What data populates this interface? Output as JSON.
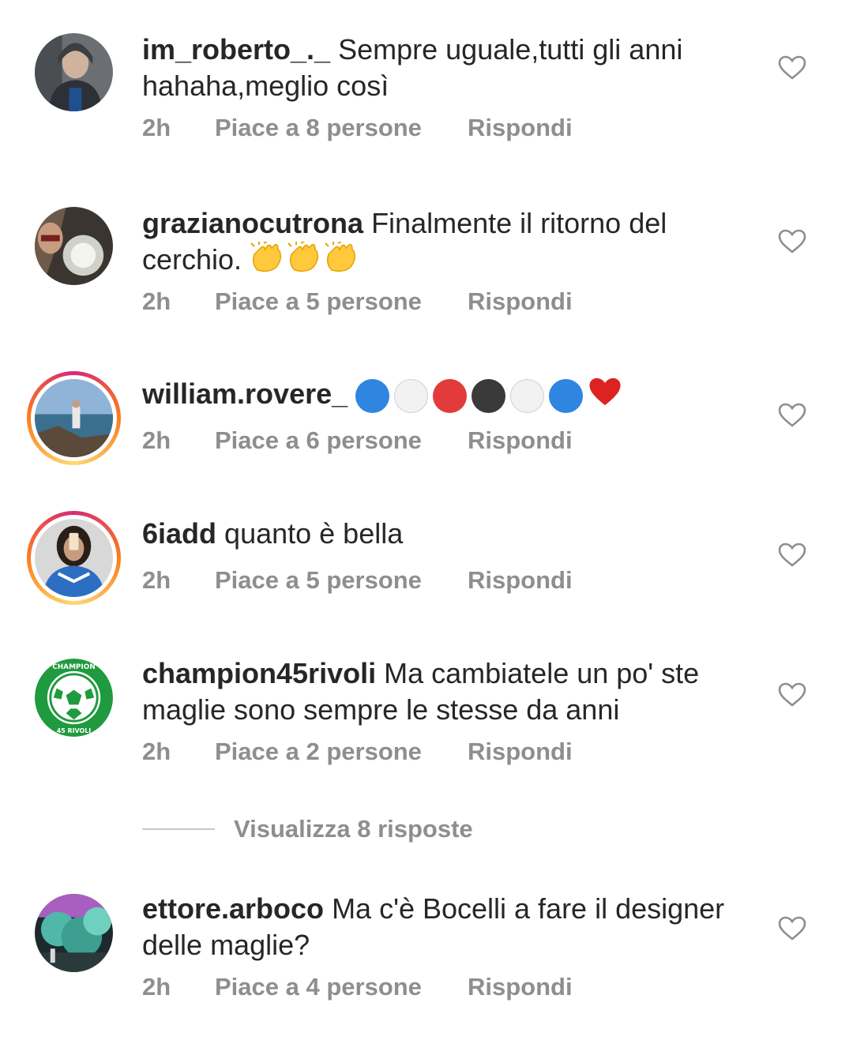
{
  "comments": [
    {
      "username": "im_roberto_._",
      "text": "Sempre uguale,tutti gli anni hahaha,meglio così",
      "time": "2h",
      "likes": "Piace a 8 persone",
      "reply": "Rispondi"
    },
    {
      "username": "grazianocutrona",
      "text": "Finalmente il ritorno del cerchio.",
      "time": "2h",
      "likes": "Piace a 5 persone",
      "reply": "Rispondi"
    },
    {
      "username": "william.rovere_",
      "text": "",
      "time": "2h",
      "likes": "Piace a 6 persone",
      "reply": "Rispondi"
    },
    {
      "username": "6iadd",
      "text": "quanto è bella",
      "time": "2h",
      "likes": "Piace a 5 persone",
      "reply": "Rispondi"
    },
    {
      "username": "champion45rivoli",
      "text": "Ma cambiatele un po' ste maglie sono sempre le stesse da anni",
      "time": "2h",
      "likes": "Piace a 2 persone",
      "reply": "Rispondi"
    },
    {
      "username": "ettore.arboco",
      "text": "Ma c'è Bocelli a fare il designer delle maglie?",
      "time": "2h",
      "likes": "Piace a 4 persone",
      "reply": "Rispondi"
    }
  ],
  "view_replies": "Visualizza 8 risposte",
  "emoji_dots": [
    "#2f86e0",
    "#f2f2f2",
    "#e23b3b",
    "#3a3a3a",
    "#f2f2f2",
    "#2f86e0"
  ],
  "avatar_badge": {
    "top": "CHAMPION",
    "bottom": "45 RIVOLI"
  },
  "colors": {
    "text": "#262626",
    "meta": "#8e8e8e",
    "heart": "#8e8e8e"
  }
}
